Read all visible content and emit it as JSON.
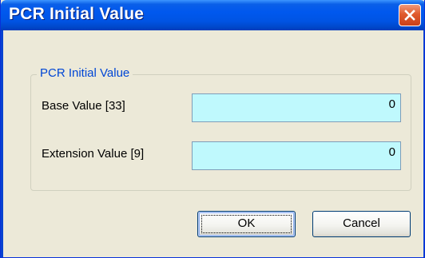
{
  "window": {
    "title": "PCR Initial Value"
  },
  "group": {
    "legend": "PCR Initial Value"
  },
  "fields": {
    "base": {
      "label": "Base Value [33]",
      "value": "0"
    },
    "extension": {
      "label": "Extension Value [9]",
      "value": "0"
    }
  },
  "buttons": {
    "ok_label": "OK",
    "cancel_label": "Cancel"
  },
  "icons": {
    "close": "close-icon"
  },
  "colors": {
    "titlebar": "#0054e3",
    "close_button": "#e05a2c",
    "legend_text": "#0046d5",
    "input_background": "#bff9fd",
    "dialog_background": "#ece9d8"
  }
}
